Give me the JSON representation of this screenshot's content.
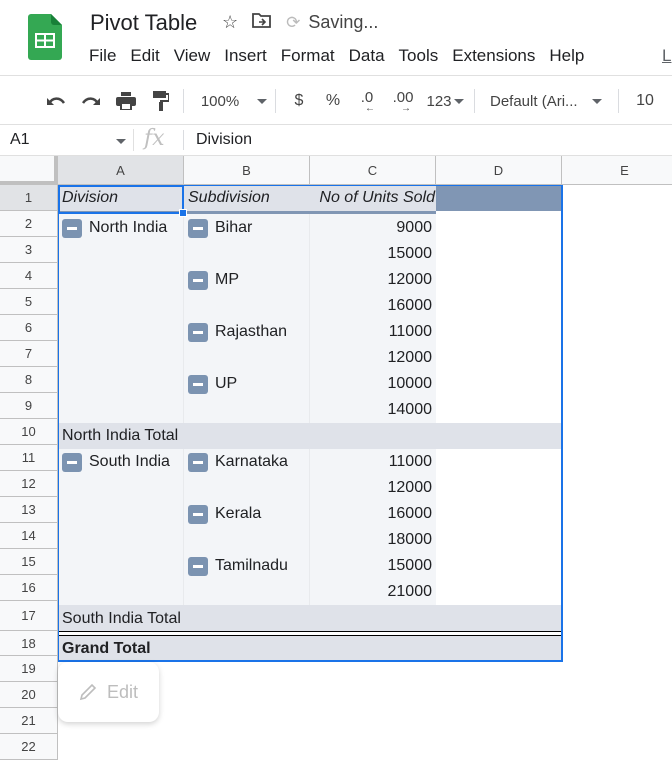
{
  "app": {
    "title": "Pivot Table",
    "status": "Saving...",
    "brand_color": "#34a853"
  },
  "menu": {
    "items": [
      "File",
      "Edit",
      "View",
      "Insert",
      "Format",
      "Data",
      "Tools",
      "Extensions",
      "Help"
    ],
    "trailing_link": "L"
  },
  "toolbar": {
    "zoom": "100%",
    "currency": "$",
    "percent": "%",
    "decrease_decimal": ".0",
    "increase_decimal": ".00",
    "number_format": "123",
    "font": "Default (Ari...",
    "font_size": "10"
  },
  "formula_bar": {
    "cell_ref": "A1",
    "fx_label": "fx",
    "value": "Division"
  },
  "columns": [
    "A",
    "B",
    "C",
    "D",
    "E"
  ],
  "rows": [
    "1",
    "2",
    "3",
    "4",
    "5",
    "6",
    "7",
    "8",
    "9",
    "10",
    "11",
    "12",
    "13",
    "14",
    "15",
    "16",
    "17",
    "18",
    "19",
    "20",
    "21",
    "22"
  ],
  "pivot": {
    "headers": [
      "Division",
      "Subdivision",
      "No of Units Sold"
    ],
    "groups": [
      {
        "division": "North India",
        "subdivisions": [
          {
            "name": "Bihar",
            "values": [
              "9000",
              "15000"
            ]
          },
          {
            "name": "MP",
            "values": [
              "12000",
              "16000"
            ]
          },
          {
            "name": "Rajasthan",
            "values": [
              "11000",
              "12000"
            ]
          },
          {
            "name": "UP",
            "values": [
              "10000",
              "14000"
            ]
          }
        ],
        "total_label": "North India Total"
      },
      {
        "division": "South India",
        "subdivisions": [
          {
            "name": "Karnataka",
            "values": [
              "11000",
              "12000"
            ]
          },
          {
            "name": "Kerala",
            "values": [
              "16000",
              "18000"
            ]
          },
          {
            "name": "Tamilnadu",
            "values": [
              "15000",
              "21000"
            ]
          }
        ],
        "total_label": "South India Total"
      }
    ],
    "grand_total_label": "Grand Total"
  },
  "edit_popup": {
    "label": "Edit"
  }
}
